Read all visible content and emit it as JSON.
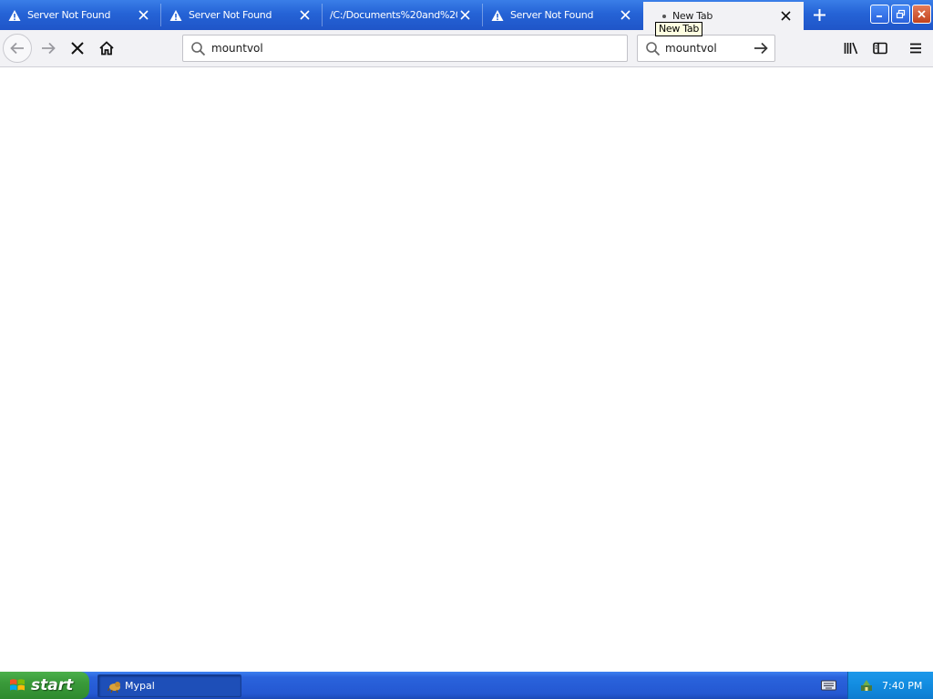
{
  "browser": {
    "tabs": [
      {
        "label": "Server Not Found",
        "icon": "warning-icon",
        "active": false
      },
      {
        "label": "Server Not Found",
        "icon": "warning-icon",
        "active": false
      },
      {
        "label": "/C:/Documents%20and%20",
        "icon": "none",
        "active": false
      },
      {
        "label": "Server Not Found",
        "icon": "warning-icon",
        "active": false
      },
      {
        "label": "New Tab",
        "icon": "loading-dot",
        "active": true
      }
    ],
    "tooltip": "New Tab",
    "url_value": "mountvol",
    "search_value": "mountvol"
  },
  "taskbar": {
    "start_label": "start",
    "task_label": "Mypal",
    "clock": "7:40 PM"
  },
  "colors": {
    "titlebar": "#2563d6",
    "toolbar": "#f2f2f5",
    "taskbar": "#2458d2",
    "start": "#3a9a3a",
    "tray": "#128ce0"
  }
}
